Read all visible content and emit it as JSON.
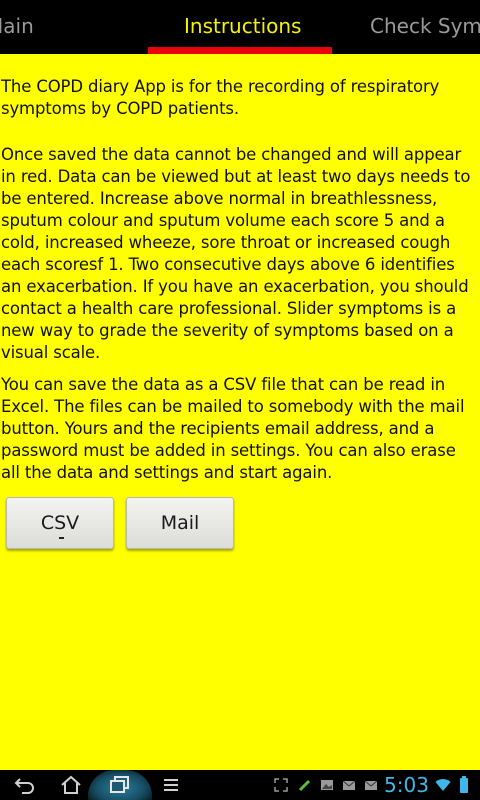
{
  "tabs": [
    {
      "label": "Main",
      "display": "Main"
    },
    {
      "label": "Instructions"
    },
    {
      "label": "Check Sym",
      "display": "Check Sym"
    }
  ],
  "colors": {
    "content_background": "#ffff00",
    "active_tab_text": "#f4f400",
    "active_tab_indicator": "#e8000b",
    "clock": "#3fb7e8"
  },
  "content": {
    "paragraph1": "The COPD diary App is for the recording of respiratory symptoms by COPD patients.",
    "paragraph2": "Once saved the data cannot be changed and will appear in red. Data can be viewed but at least two days needs to be entered. Increase above normal in breathlessness, sputum colour and sputum volume each score 5 and a cold, increased wheeze, sore throat or increased cough each scoresf 1. Two consecutive days above 6 identifies an exacerbation. If you have an exacerbation, you should contact a health care professional. Slider symptoms is a new way to grade the severity of symptoms based on a visual scale.",
    "paragraph3": "You can save the data as a CSV file that can be read in Excel. The files can be mailed to somebody with the mail button. Yours and the recipients email address, and a password must be added in settings. You can also erase all the data and settings and start again.",
    "csv_button": "CSV",
    "mail_button": "Mail"
  },
  "system_bar": {
    "clock": "5:03",
    "icons": [
      "back-icon",
      "home-icon",
      "recent-apps-icon",
      "menu-icon",
      "expand-icon",
      "pencil-icon",
      "image-icon",
      "mail-icon",
      "mail-icon",
      "wifi-icon",
      "battery-icon"
    ]
  }
}
